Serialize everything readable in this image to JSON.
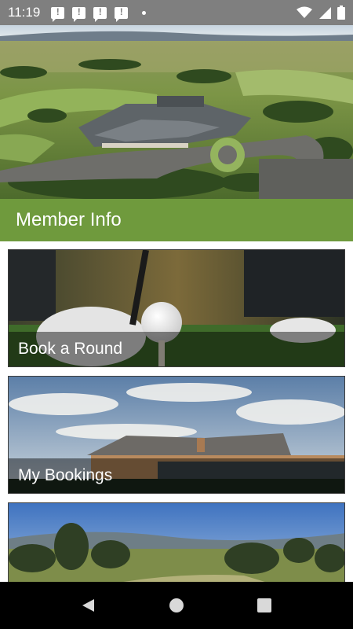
{
  "status_bar": {
    "time": "11:19",
    "notification_count": 4,
    "icons": [
      "message-alert-icon",
      "wifi-icon",
      "signal-icon",
      "battery-icon"
    ]
  },
  "header": {
    "title": "Member Info"
  },
  "cards": [
    {
      "label": "Book a Round"
    },
    {
      "label": "My Bookings"
    },
    {
      "label": ""
    }
  ],
  "nav_bar": {
    "icons": [
      "back-icon",
      "home-icon",
      "recents-icon"
    ]
  },
  "colors": {
    "accent_green": "#6f9a3d",
    "status_bar_bg": "#7f7f7f",
    "nav_bar_bg": "#000000"
  }
}
